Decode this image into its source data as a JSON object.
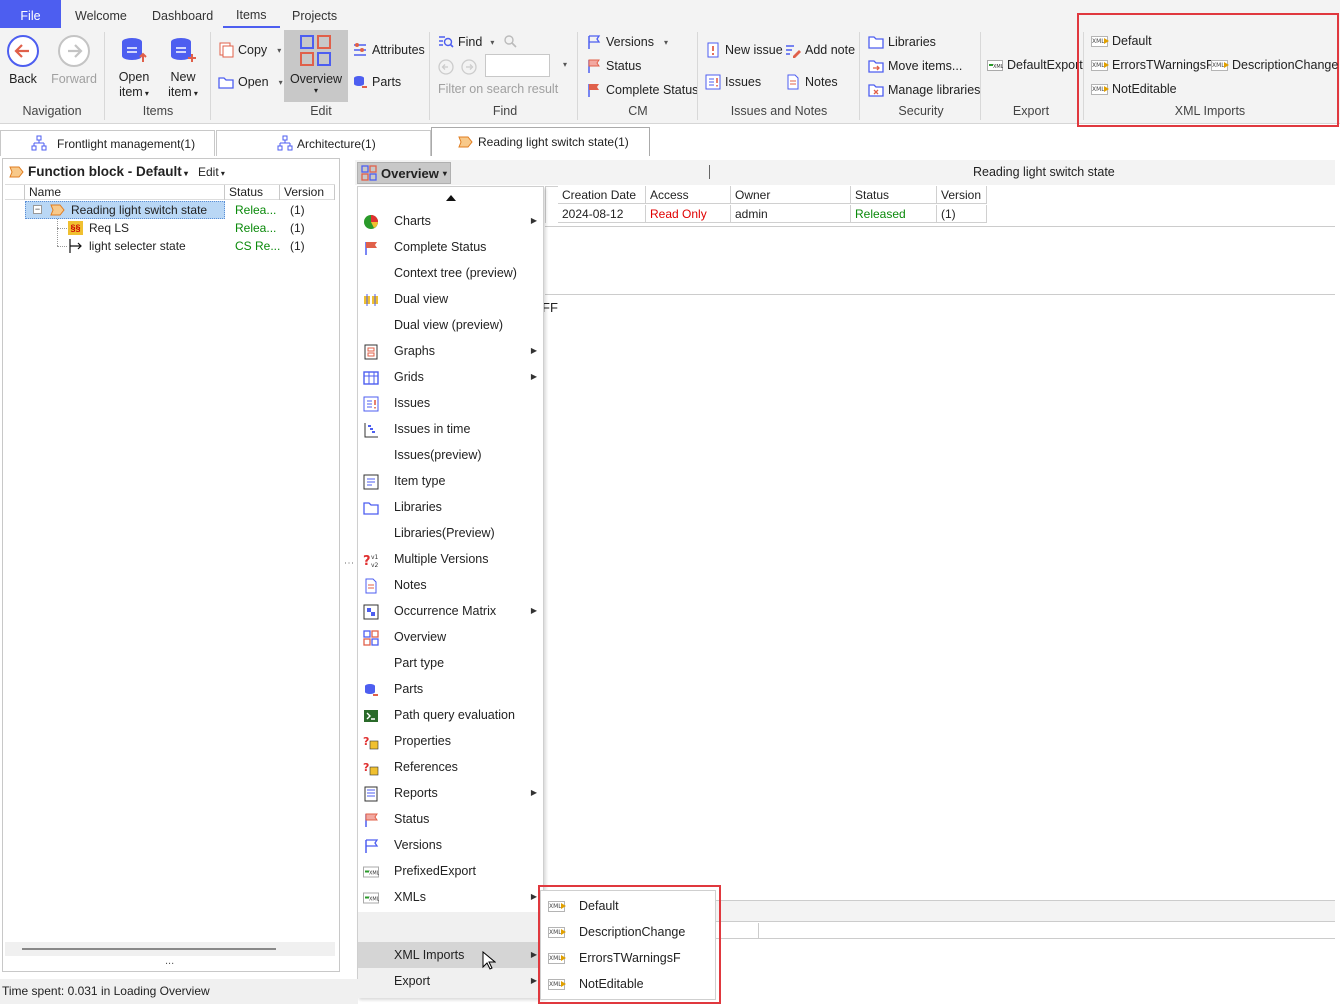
{
  "menubar": {
    "file": "File",
    "tabs": [
      "Welcome",
      "Dashboard",
      "Items",
      "Projects"
    ]
  },
  "ribbon": {
    "navigation": {
      "back": "Back",
      "forward": "Forward",
      "label": "Navigation"
    },
    "items": {
      "open": "Open",
      "open2": "item",
      "new": "New",
      "new2": "item",
      "label": "Items"
    },
    "edit": {
      "copy": "Copy",
      "open": "Open",
      "overview": "Overview",
      "attributes": "Attributes",
      "parts": "Parts",
      "label": "Edit"
    },
    "find": {
      "find": "Find",
      "placeholder": "Filter on search result",
      "label": "Find"
    },
    "cm": {
      "versions": "Versions",
      "status": "Status",
      "complete_status": "Complete Status",
      "label": "CM"
    },
    "issues": {
      "new_issue": "New issue",
      "add_note": "Add note",
      "issues": "Issues",
      "notes": "Notes",
      "label": "Issues and Notes"
    },
    "security": {
      "libraries": "Libraries",
      "move_items": "Move items...",
      "manage_libraries": "Manage libraries",
      "label": "Security"
    },
    "export": {
      "default_export": "DefaultExport",
      "label": "Export"
    },
    "xml_imports": {
      "default": "Default",
      "errors": "ErrorsTWarningsF",
      "description": "DescriptionChange",
      "not_editable": "NotEditable",
      "label": "XML Imports"
    }
  },
  "doc_tabs": [
    "Frontlight management(1)",
    "Architecture(1)",
    "Reading light switch state(1)"
  ],
  "left_panel": {
    "title": "Function block - Default",
    "edit": "Edit",
    "columns": [
      "Name",
      "Status",
      "Version"
    ],
    "rows": [
      {
        "name": "Reading light switch state",
        "status": "Relea...",
        "version": "(1)"
      },
      {
        "name": "Req LS",
        "status": "Relea...",
        "version": "(1)"
      },
      {
        "name": "light selecter state",
        "status": "CS Re...",
        "version": "(1)"
      }
    ],
    "ellipsis": "..."
  },
  "center": {
    "view_button": "Overview",
    "title": "Reading light switch state",
    "columns": [
      "Creation Date",
      "Access",
      "Owner",
      "Status",
      "Version"
    ],
    "row": {
      "creation_date": "2024-08-12",
      "access": "Read Only",
      "owner": "admin",
      "status": "Released",
      "version": "(1)"
    },
    "fragment": "FF"
  },
  "menu": {
    "items": [
      "Charts",
      "Complete Status",
      "Context tree (preview)",
      "Dual view",
      "Dual view (preview)",
      "Graphs",
      "Grids",
      "Issues",
      "Issues in time",
      "Issues(preview)",
      "Item type",
      "Libraries",
      "Libraries(Preview)",
      "Multiple Versions",
      "Notes",
      "Occurrence Matrix",
      "Overview",
      "Part type",
      "Parts",
      "Path query evaluation",
      "Properties",
      "References",
      "Reports",
      "Status",
      "Versions",
      "PrefixedExport",
      "XMLs"
    ],
    "xml_imports": "XML Imports",
    "export": "Export"
  },
  "submenu": {
    "items": [
      "Default",
      "DescriptionChange",
      "ErrorsTWarningsF",
      "NotEditable"
    ]
  },
  "status_bar": "Time spent: 0.031 in Loading Overview",
  "colors": {
    "accent": "#4d5ef0",
    "highlight_box": "#e0383e",
    "released": "#0a8a0a",
    "read_only": "#e00000",
    "selection": "#b9d7f5"
  }
}
